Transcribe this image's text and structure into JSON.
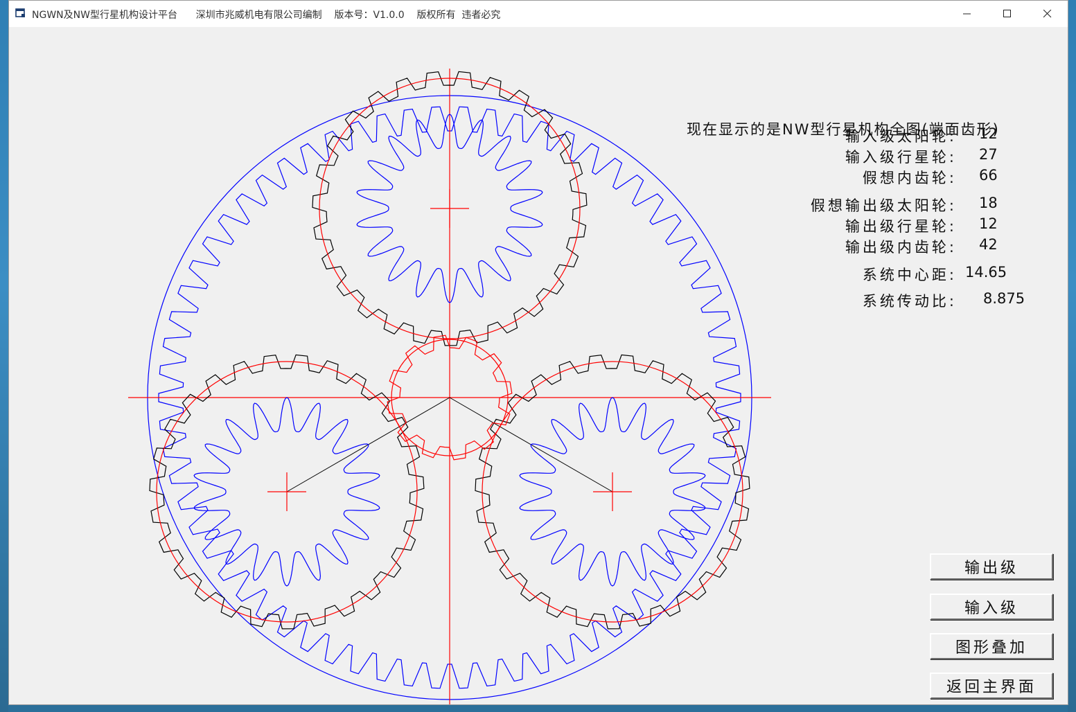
{
  "window": {
    "title": "NGWN及NW型行星机构设计平台      深圳市兆威机电有限公司编制    版本号：V1.0.0    版权所有  违者必究"
  },
  "info": {
    "heading": "现在显示的是NW型行星机构全图(端面齿形)",
    "rows": [
      {
        "label": "输入级太阳轮:",
        "value": "12"
      },
      {
        "label": "输入级行星轮:",
        "value": "27"
      },
      {
        "label": "假想内齿轮:",
        "value": "66"
      },
      {
        "label": "假想输出级太阳轮:",
        "value": "18"
      },
      {
        "label": "输出级行星轮:",
        "value": "12"
      },
      {
        "label": "输出级内齿轮:",
        "value": "42"
      },
      {
        "label": "系统中心距:",
        "value": "14.65"
      },
      {
        "label": "系统传动比:",
        "value": "8.875"
      }
    ]
  },
  "buttons": {
    "output_stage": "输出级",
    "input_stage": "输入级",
    "overlay": "图形叠加",
    "back_main": "返回主界面"
  },
  "gears": {
    "input_sun_teeth": 12,
    "input_planet_teeth": 27,
    "virtual_ring_teeth": 66,
    "output_sun_teeth": 18,
    "output_planet_teeth": 12,
    "output_ring_teeth": 42
  },
  "colors": {
    "blue": "#0000ff",
    "red": "#ff0000",
    "black": "#000000"
  }
}
